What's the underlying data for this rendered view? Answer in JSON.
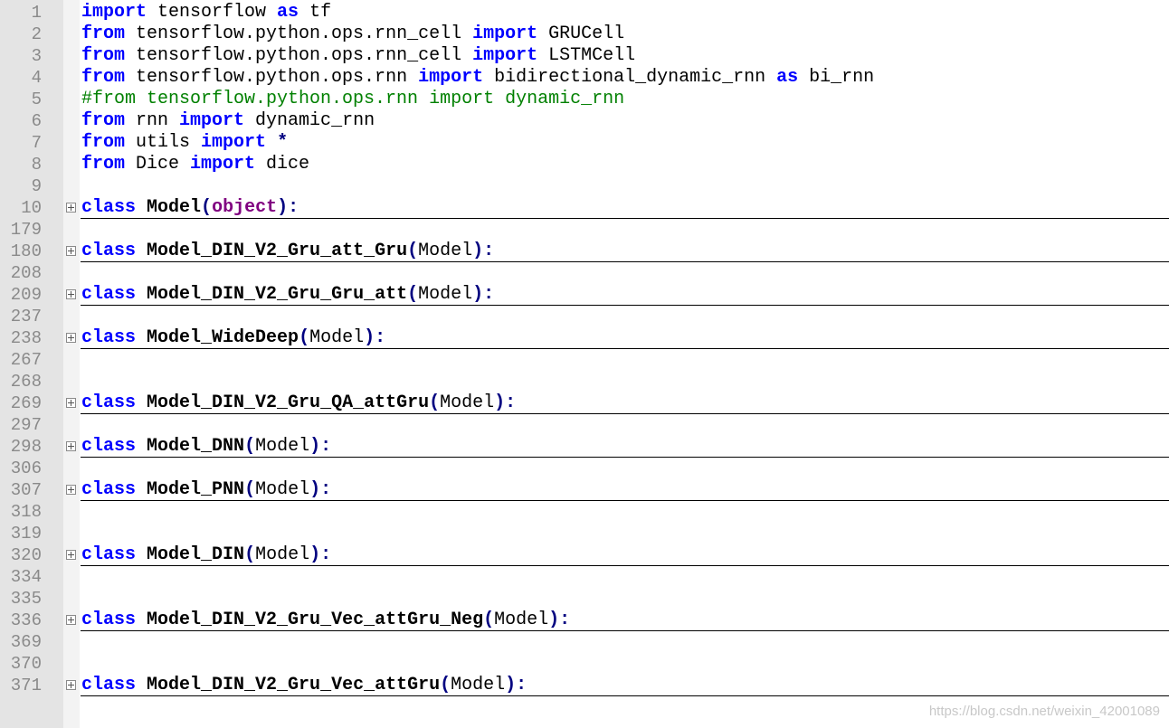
{
  "lines": [
    {
      "num": "1",
      "fold": false,
      "tokens": [
        {
          "t": "kw",
          "v": "import"
        },
        {
          "t": "tx",
          "v": " tensorflow "
        },
        {
          "t": "kw",
          "v": "as"
        },
        {
          "t": "tx",
          "v": " tf"
        }
      ]
    },
    {
      "num": "2",
      "fold": false,
      "tokens": [
        {
          "t": "kw",
          "v": "from"
        },
        {
          "t": "tx",
          "v": " tensorflow.python.ops.rnn_cell "
        },
        {
          "t": "kw",
          "v": "import"
        },
        {
          "t": "tx",
          "v": " GRUCell"
        }
      ]
    },
    {
      "num": "3",
      "fold": false,
      "tokens": [
        {
          "t": "kw",
          "v": "from"
        },
        {
          "t": "tx",
          "v": " tensorflow.python.ops.rnn_cell "
        },
        {
          "t": "kw",
          "v": "import"
        },
        {
          "t": "tx",
          "v": " LSTMCell"
        }
      ]
    },
    {
      "num": "4",
      "fold": false,
      "tokens": [
        {
          "t": "kw",
          "v": "from"
        },
        {
          "t": "tx",
          "v": " tensorflow.python.ops.rnn "
        },
        {
          "t": "kw",
          "v": "import"
        },
        {
          "t": "tx",
          "v": " bidirectional_dynamic_rnn "
        },
        {
          "t": "kw",
          "v": "as"
        },
        {
          "t": "tx",
          "v": " bi_rnn"
        }
      ]
    },
    {
      "num": "5",
      "fold": false,
      "tokens": [
        {
          "t": "cm",
          "v": "#from tensorflow.python.ops.rnn import dynamic_rnn"
        }
      ]
    },
    {
      "num": "6",
      "fold": false,
      "tokens": [
        {
          "t": "kw",
          "v": "from"
        },
        {
          "t": "tx",
          "v": " rnn "
        },
        {
          "t": "kw",
          "v": "import"
        },
        {
          "t": "tx",
          "v": " dynamic_rnn"
        }
      ]
    },
    {
      "num": "7",
      "fold": false,
      "tokens": [
        {
          "t": "kw",
          "v": "from"
        },
        {
          "t": "tx",
          "v": " utils "
        },
        {
          "t": "kw",
          "v": "import"
        },
        {
          "t": "tx",
          "v": " "
        },
        {
          "t": "op",
          "v": "*"
        }
      ]
    },
    {
      "num": "8",
      "fold": false,
      "tokens": [
        {
          "t": "kw",
          "v": "from"
        },
        {
          "t": "tx",
          "v": " Dice "
        },
        {
          "t": "kw",
          "v": "import"
        },
        {
          "t": "tx",
          "v": " dice"
        }
      ]
    },
    {
      "num": "9",
      "fold": false,
      "tokens": []
    },
    {
      "num": "10",
      "fold": true,
      "tokens": [
        {
          "t": "kw",
          "v": "class"
        },
        {
          "t": "tx",
          "v": " "
        },
        {
          "t": "cls",
          "v": "Model"
        },
        {
          "t": "op",
          "v": "("
        },
        {
          "t": "bi",
          "v": "object"
        },
        {
          "t": "op",
          "v": "):"
        }
      ]
    },
    {
      "num": "179",
      "fold": false,
      "tokens": []
    },
    {
      "num": "180",
      "fold": true,
      "tokens": [
        {
          "t": "kw",
          "v": "class"
        },
        {
          "t": "tx",
          "v": " "
        },
        {
          "t": "cls",
          "v": "Model_DIN_V2_Gru_att_Gru"
        },
        {
          "t": "op",
          "v": "("
        },
        {
          "t": "tx",
          "v": "Model"
        },
        {
          "t": "op",
          "v": "):"
        }
      ]
    },
    {
      "num": "208",
      "fold": false,
      "tokens": []
    },
    {
      "num": "209",
      "fold": true,
      "tokens": [
        {
          "t": "kw",
          "v": "class"
        },
        {
          "t": "tx",
          "v": " "
        },
        {
          "t": "cls",
          "v": "Model_DIN_V2_Gru_Gru_att"
        },
        {
          "t": "op",
          "v": "("
        },
        {
          "t": "tx",
          "v": "Model"
        },
        {
          "t": "op",
          "v": "):"
        }
      ]
    },
    {
      "num": "237",
      "fold": false,
      "tokens": []
    },
    {
      "num": "238",
      "fold": true,
      "tokens": [
        {
          "t": "kw",
          "v": "class"
        },
        {
          "t": "tx",
          "v": " "
        },
        {
          "t": "cls",
          "v": "Model_WideDeep"
        },
        {
          "t": "op",
          "v": "("
        },
        {
          "t": "tx",
          "v": "Model"
        },
        {
          "t": "op",
          "v": "):"
        }
      ]
    },
    {
      "num": "267",
      "fold": false,
      "tokens": []
    },
    {
      "num": "268",
      "fold": false,
      "tokens": []
    },
    {
      "num": "269",
      "fold": true,
      "tokens": [
        {
          "t": "kw",
          "v": "class"
        },
        {
          "t": "tx",
          "v": " "
        },
        {
          "t": "cls",
          "v": "Model_DIN_V2_Gru_QA_attGru"
        },
        {
          "t": "op",
          "v": "("
        },
        {
          "t": "tx",
          "v": "Model"
        },
        {
          "t": "op",
          "v": "):"
        }
      ]
    },
    {
      "num": "297",
      "fold": false,
      "tokens": []
    },
    {
      "num": "298",
      "fold": true,
      "tokens": [
        {
          "t": "kw",
          "v": "class"
        },
        {
          "t": "tx",
          "v": " "
        },
        {
          "t": "cls",
          "v": "Model_DNN"
        },
        {
          "t": "op",
          "v": "("
        },
        {
          "t": "tx",
          "v": "Model"
        },
        {
          "t": "op",
          "v": "):"
        }
      ]
    },
    {
      "num": "306",
      "fold": false,
      "tokens": []
    },
    {
      "num": "307",
      "fold": true,
      "tokens": [
        {
          "t": "kw",
          "v": "class"
        },
        {
          "t": "tx",
          "v": " "
        },
        {
          "t": "cls",
          "v": "Model_PNN"
        },
        {
          "t": "op",
          "v": "("
        },
        {
          "t": "tx",
          "v": "Model"
        },
        {
          "t": "op",
          "v": "):"
        }
      ]
    },
    {
      "num": "318",
      "fold": false,
      "tokens": []
    },
    {
      "num": "319",
      "fold": false,
      "tokens": []
    },
    {
      "num": "320",
      "fold": true,
      "tokens": [
        {
          "t": "kw",
          "v": "class"
        },
        {
          "t": "tx",
          "v": " "
        },
        {
          "t": "cls",
          "v": "Model_DIN"
        },
        {
          "t": "op",
          "v": "("
        },
        {
          "t": "tx",
          "v": "Model"
        },
        {
          "t": "op",
          "v": "):"
        }
      ]
    },
    {
      "num": "334",
      "fold": false,
      "tokens": []
    },
    {
      "num": "335",
      "fold": false,
      "tokens": []
    },
    {
      "num": "336",
      "fold": true,
      "tokens": [
        {
          "t": "kw",
          "v": "class"
        },
        {
          "t": "tx",
          "v": " "
        },
        {
          "t": "cls",
          "v": "Model_DIN_V2_Gru_Vec_attGru_Neg"
        },
        {
          "t": "op",
          "v": "("
        },
        {
          "t": "tx",
          "v": "Model"
        },
        {
          "t": "op",
          "v": "):"
        }
      ]
    },
    {
      "num": "369",
      "fold": false,
      "tokens": []
    },
    {
      "num": "370",
      "fold": false,
      "tokens": []
    },
    {
      "num": "371",
      "fold": true,
      "tokens": [
        {
          "t": "kw",
          "v": "class"
        },
        {
          "t": "tx",
          "v": " "
        },
        {
          "t": "cls",
          "v": "Model_DIN_V2_Gru_Vec_attGru"
        },
        {
          "t": "op",
          "v": "("
        },
        {
          "t": "tx",
          "v": "Model"
        },
        {
          "t": "op",
          "v": "):"
        }
      ]
    }
  ],
  "watermark": "https://blog.csdn.net/weixin_42001089",
  "colors": {
    "keyword": "#0000ff",
    "comment": "#008000",
    "builtin": "#800080",
    "operator": "#000080",
    "gutter": "#e4e4e4"
  }
}
